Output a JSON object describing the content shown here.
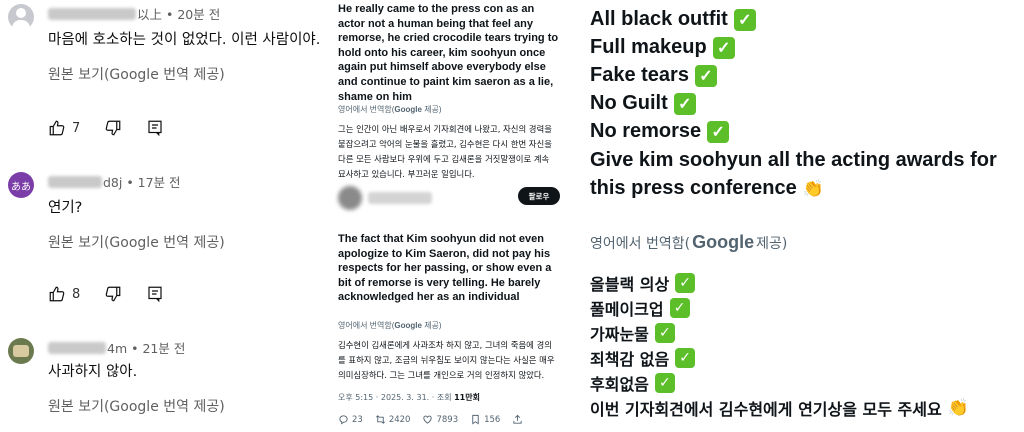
{
  "yt": {
    "comments": [
      {
        "meta": "以上 • 20분 전",
        "text": "마음에 호소하는 것이 없었다. 이런 사람이야.",
        "translate": "원본 보기(Google 번역 제공)",
        "likes": "7"
      },
      {
        "avatar_text": "ああ",
        "meta": "d8j • 17분 전",
        "text": "연기?",
        "translate": "원본 보기(Google 번역 제공)",
        "likes": "8"
      },
      {
        "meta": "4m • 21분 전",
        "text": "사과하지 않아.",
        "translate": "원본 보기(Google 번역 제공)"
      }
    ]
  },
  "x": {
    "tweet1": "He really came to the press con as an actor not a human being that feel any remorse, he cried crocodile tears trying to hold onto his career, kim soohyun once again put himself above everybody else and continue to paint kim saeron as a lie, shame on him",
    "translated_prefix": "영어에서 번역함(",
    "google": "Google",
    "translated_suffix": " 제공)",
    "tweet1_ko": "그는 인간이 아닌 배우로서 기자회견에 나왔고, 자신의 경력을 붙잡으려고 악어의 눈물을 흘렸고, 김수현은 다시 한번 자신을 다른 모든 사람보다 우위에 두고 김새론을 거짓말쟁이로 계속 묘사하고 있습니다. 부끄러운 일입니다.",
    "follow": "팔로우",
    "tweet2": "The fact that Kim soohyun did not even apologize to Kim Saeron, did not pay his respects for her passing, or show even a bit of remorse is very telling. He barely acknowledged her as an individual",
    "tweet2_ko": "김수현이 김새론에게 사과조차 하지 않고, 그녀의 죽음에 경의를 표하지 않고, 조금의 뉘우침도 보이지 않는다는 사실은 매우 의미심장하다. 그는 그녀를 개인으로 거의 인정하지 않았다.",
    "meta_time": "오후 5:15 · 2025. 3. 31. · 조회 ",
    "meta_views": "11만회",
    "stats": {
      "replies": "23",
      "retweets": "2420",
      "likes": "7893",
      "bookmarks": "156"
    }
  },
  "img": {
    "lines": [
      "All black outfit",
      "Full makeup",
      "Fake tears",
      "No Guilt",
      "No remorse"
    ],
    "award1": "Give kim soohyun all the acting awards for",
    "award2": "this press conference",
    "translated_prefix": "영어에서 번역함(",
    "google": "Google",
    "translated_suffix": " 제공)",
    "ko_lines": [
      "올블랙 의상",
      "풀메이크업",
      "가짜눈물",
      "죄책감 없음",
      "후회없음"
    ],
    "ko_award": "이번 기자회견에서 김수현에게 연기상을 모두 주세요",
    "check_glyph": "✓",
    "clap_glyph": "👏"
  },
  "colors": {
    "check": "#5cbf2a",
    "youtube_text": "#0f0f0f",
    "muted": "#606060",
    "x_text": "#0f1419",
    "x_muted": "#536471"
  }
}
